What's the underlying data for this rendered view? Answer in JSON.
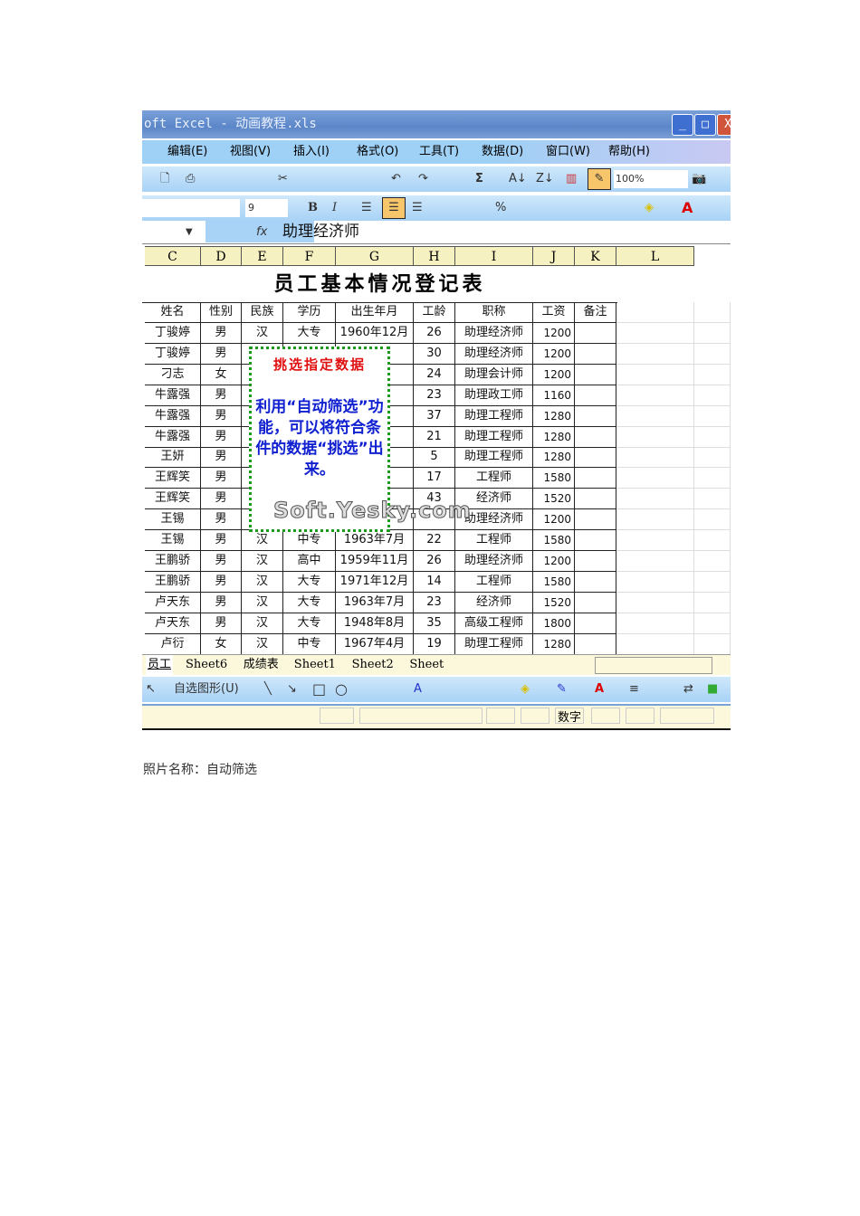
{
  "window": {
    "title": "oft Excel - 动画教程.xls"
  },
  "menu": [
    "编辑(E)",
    "视图(V)",
    "插入(I)",
    "格式(O)",
    "工具(T)",
    "数据(D)",
    "窗口(W)",
    "帮助(H)"
  ],
  "toolbar": {
    "zoom": "100%",
    "font_size": "9",
    "bold": "B",
    "italic": "I",
    "sum": "Σ",
    "percent": "%"
  },
  "formula_bar": {
    "fx": "fx",
    "value": "助理经济师"
  },
  "columns": [
    "C",
    "D",
    "E",
    "F",
    "G",
    "H",
    "I",
    "J",
    "K",
    "L"
  ],
  "sheet_title": "员工基本情况登记表",
  "headers": [
    "姓名",
    "性别",
    "民族",
    "学历",
    "出生年月",
    "工龄",
    "职称",
    "工资",
    "备注"
  ],
  "rows": [
    [
      "丁骏婷",
      "男",
      "汉",
      "大专",
      "1960年12月",
      "26",
      "助理经济师",
      "1200",
      ""
    ],
    [
      "丁骏婷",
      "男",
      "",
      "",
      "2月",
      "30",
      "助理经济师",
      "1200",
      ""
    ],
    [
      "刁志",
      "女",
      "",
      "",
      "月",
      "24",
      "助理会计师",
      "1200",
      ""
    ],
    [
      "牛露强",
      "男",
      "",
      "",
      "月",
      "23",
      "助理政工师",
      "1160",
      ""
    ],
    [
      "牛露强",
      "男",
      "",
      "",
      "月",
      "37",
      "助理工程师",
      "1280",
      ""
    ],
    [
      "牛露强",
      "男",
      "",
      "",
      "月",
      "21",
      "助理工程师",
      "1280",
      ""
    ],
    [
      "王妍",
      "男",
      "",
      "",
      "2月",
      "5",
      "助理工程师",
      "1280",
      ""
    ],
    [
      "王辉笑",
      "男",
      "",
      "",
      "2月",
      "17",
      "工程师",
      "1580",
      ""
    ],
    [
      "王辉笑",
      "男",
      "",
      "",
      "1月",
      "43",
      "经济师",
      "1520",
      ""
    ],
    [
      "王锡",
      "男",
      "",
      "",
      "",
      "",
      "助理经济师",
      "1200",
      ""
    ],
    [
      "王锡",
      "男",
      "汉",
      "中专",
      "1963年7月",
      "22",
      "工程师",
      "1580",
      ""
    ],
    [
      "王鹏骄",
      "男",
      "汉",
      "高中",
      "1959年11月",
      "26",
      "助理经济师",
      "1200",
      ""
    ],
    [
      "王鹏骄",
      "男",
      "汉",
      "大专",
      "1971年12月",
      "14",
      "工程师",
      "1580",
      ""
    ],
    [
      "卢天东",
      "男",
      "汉",
      "大专",
      "1963年7月",
      "23",
      "经济师",
      "1520",
      ""
    ],
    [
      "卢天东",
      "男",
      "汉",
      "大专",
      "1948年8月",
      "35",
      "高级工程师",
      "1800",
      ""
    ],
    [
      "卢衍",
      "女",
      "汉",
      "中专",
      "1967年4月",
      "19",
      "助理工程师",
      "1280",
      ""
    ]
  ],
  "callout": {
    "heading": "挑选指定数据",
    "body": "利用“自动筛选”功能，可以将符合条件的数据“挑选”出来。"
  },
  "watermark": "Soft.Yesky.com",
  "sheet_tabs": [
    "员工",
    "Sheet6",
    "成绩表",
    "Sheet1",
    "Sheet2",
    "Sheet"
  ],
  "drawing_toolbar": {
    "autoshapes": "自选图形(U)"
  },
  "status": {
    "mode": "数字"
  },
  "caption": "照片名称：自动筛选"
}
